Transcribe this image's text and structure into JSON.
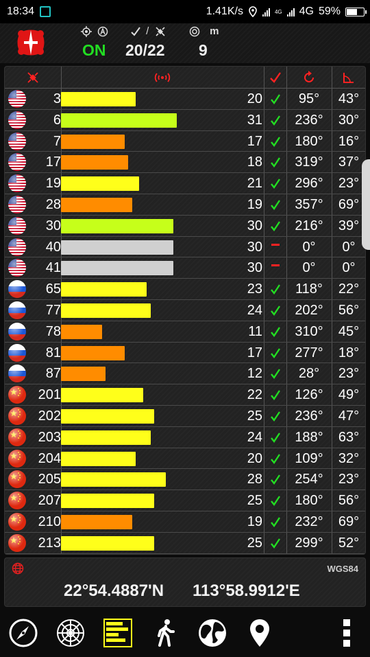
{
  "status_bar": {
    "time": "18:34",
    "net_speed": "1.41K/s",
    "net_badge_small": "4G",
    "net_type": "4G",
    "battery": "59%"
  },
  "header": {
    "status_label": "ON",
    "sats_fix": "20",
    "sats_slash": "/",
    "sats_view": "22",
    "accuracy_unit": "m",
    "accuracy_value": "9",
    "accent_on": "#22dd22"
  },
  "satellites": [
    {
      "flag": "usa",
      "prn": "3",
      "snr": "20",
      "level": 20,
      "bar_color": "#ffff1a",
      "used": true,
      "az": "95°",
      "el": "43°"
    },
    {
      "flag": "usa",
      "prn": "6",
      "snr": "31",
      "level": 31,
      "bar_color": "#c6ff1a",
      "used": true,
      "az": "236°",
      "el": "30°"
    },
    {
      "flag": "usa",
      "prn": "7",
      "snr": "17",
      "level": 17,
      "bar_color": "#ff8c00",
      "used": true,
      "az": "180°",
      "el": "16°"
    },
    {
      "flag": "usa",
      "prn": "17",
      "snr": "18",
      "level": 18,
      "bar_color": "#ff8c00",
      "used": true,
      "az": "319°",
      "el": "37°"
    },
    {
      "flag": "usa",
      "prn": "19",
      "snr": "21",
      "level": 21,
      "bar_color": "#ffff1a",
      "used": true,
      "az": "296°",
      "el": "23°"
    },
    {
      "flag": "usa",
      "prn": "28",
      "snr": "19",
      "level": 19,
      "bar_color": "#ff8c00",
      "used": true,
      "az": "357°",
      "el": "69°"
    },
    {
      "flag": "usa",
      "prn": "30",
      "snr": "30",
      "level": 30,
      "bar_color": "#c6ff1a",
      "used": true,
      "az": "216°",
      "el": "39°"
    },
    {
      "flag": "usa",
      "prn": "40",
      "snr": "30",
      "level": 30,
      "bar_color": "#d0d0d0",
      "used": false,
      "az": "0°",
      "el": "0°"
    },
    {
      "flag": "usa",
      "prn": "41",
      "snr": "30",
      "level": 30,
      "bar_color": "#d0d0d0",
      "used": false,
      "az": "0°",
      "el": "0°"
    },
    {
      "flag": "russia",
      "prn": "65",
      "snr": "23",
      "level": 23,
      "bar_color": "#ffff1a",
      "used": true,
      "az": "118°",
      "el": "22°"
    },
    {
      "flag": "russia",
      "prn": "77",
      "snr": "24",
      "level": 24,
      "bar_color": "#ffff1a",
      "used": true,
      "az": "202°",
      "el": "56°"
    },
    {
      "flag": "russia",
      "prn": "78",
      "snr": "11",
      "level": 11,
      "bar_color": "#ff8c00",
      "used": true,
      "az": "310°",
      "el": "45°"
    },
    {
      "flag": "russia",
      "prn": "81",
      "snr": "17",
      "level": 17,
      "bar_color": "#ff8c00",
      "used": true,
      "az": "277°",
      "el": "18°"
    },
    {
      "flag": "russia",
      "prn": "87",
      "snr": "12",
      "level": 12,
      "bar_color": "#ff8c00",
      "used": true,
      "az": "28°",
      "el": "23°"
    },
    {
      "flag": "china",
      "prn": "201",
      "snr": "22",
      "level": 22,
      "bar_color": "#ffff1a",
      "used": true,
      "az": "126°",
      "el": "49°"
    },
    {
      "flag": "china",
      "prn": "202",
      "snr": "25",
      "level": 25,
      "bar_color": "#ffff1a",
      "used": true,
      "az": "236°",
      "el": "47°"
    },
    {
      "flag": "china",
      "prn": "203",
      "snr": "24",
      "level": 24,
      "bar_color": "#ffff1a",
      "used": true,
      "az": "188°",
      "el": "63°"
    },
    {
      "flag": "china",
      "prn": "204",
      "snr": "20",
      "level": 20,
      "bar_color": "#ffff1a",
      "used": true,
      "az": "109°",
      "el": "32°"
    },
    {
      "flag": "china",
      "prn": "205",
      "snr": "28",
      "level": 28,
      "bar_color": "#ffff1a",
      "used": true,
      "az": "254°",
      "el": "23°"
    },
    {
      "flag": "china",
      "prn": "207",
      "snr": "25",
      "level": 25,
      "bar_color": "#ffff1a",
      "used": true,
      "az": "180°",
      "el": "56°"
    },
    {
      "flag": "china",
      "prn": "210",
      "snr": "19",
      "level": 19,
      "bar_color": "#ff8c00",
      "used": true,
      "az": "232°",
      "el": "69°"
    },
    {
      "flag": "china",
      "prn": "213",
      "snr": "25",
      "level": 25,
      "bar_color": "#ffff1a",
      "used": true,
      "az": "299°",
      "el": "52°"
    }
  ],
  "coordinates": {
    "datum": "WGS84",
    "latitude": "22°54.4887'N",
    "longitude": "113°58.9912'E"
  },
  "colors": {
    "check_green": "#22dd22",
    "header_red": "#ff2222",
    "nav_active": "#ffff1a"
  },
  "nav": [
    "compass-icon",
    "radar-icon",
    "signal-bars-icon",
    "walker-icon",
    "globe-icon",
    "location-pin-icon",
    "more-icon"
  ]
}
